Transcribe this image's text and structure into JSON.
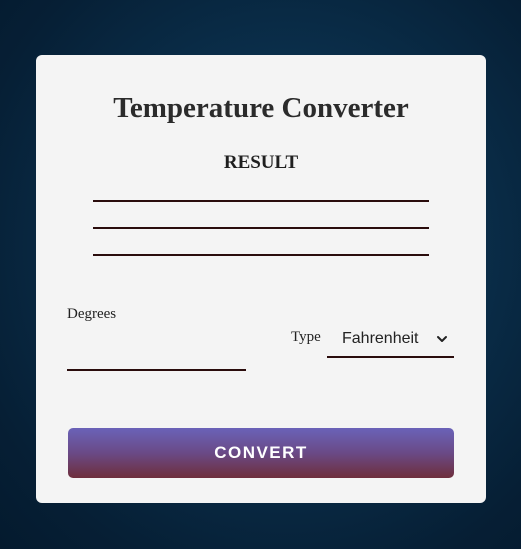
{
  "app": {
    "title": "Temperature Converter",
    "result_label": "RESULT",
    "result_lines": [
      "",
      "",
      ""
    ]
  },
  "form": {
    "degrees_label": "Degrees",
    "degrees_value": "",
    "type_label": "Type",
    "type_selected": "Fahrenheit",
    "convert_label": "CONVERT"
  },
  "icons": {
    "select_chevron": "chevron-down-icon"
  },
  "colors": {
    "background": "#0a2e4a",
    "card": "#f4f4f4",
    "underline": "#2a0c0c",
    "button_top": "#6a62b8",
    "button_bottom": "#6e2e3c",
    "button_text": "#ffffff"
  }
}
